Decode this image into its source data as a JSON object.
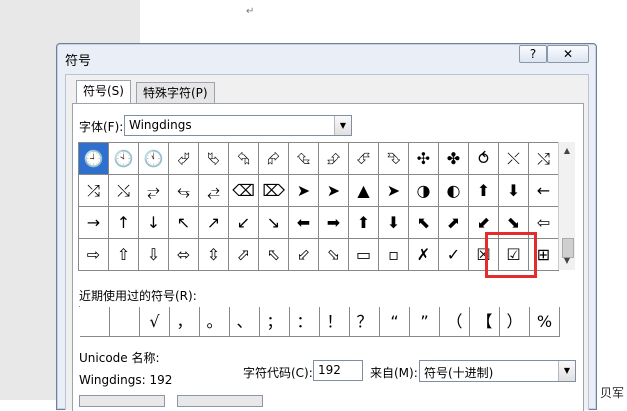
{
  "doc": {
    "paragraph_mark": "↵",
    "watermark": "贝军"
  },
  "dialog": {
    "title": "符号",
    "help_label": "?",
    "close_label": "✕",
    "tabs": [
      {
        "label": "符号(S)"
      },
      {
        "label": "特殊字符(P)"
      }
    ],
    "font_label": "字体(F):",
    "font_value": "Wingdings",
    "recent_label": "近期使用过的符号(R):",
    "unicode_name_label": "Unicode 名称:",
    "unicode_name_value": "Wingdings: 192",
    "char_code_label": "字符代码(C):",
    "char_code_value": "192",
    "from_label": "来自(M):",
    "from_value": "符号(十进制)"
  },
  "symbols": [
    [
      "🕘",
      "🕙",
      "🕚",
      "⮰",
      "⮱",
      "⮲",
      "⮳",
      "⮴",
      "⮵",
      "⮶",
      "⮷",
      "✣",
      "✤",
      "⥀",
      "⤬",
      "⤭"
    ],
    [
      "⤮",
      "⤯",
      "⥂",
      "⥃",
      "⥄",
      "⌫",
      "⌦",
      "➤",
      "➤",
      "▲",
      "➤",
      "◑",
      "◐",
      "⬆",
      "⬇",
      "←"
    ],
    [
      "→",
      "↑",
      "↓",
      "↖",
      "↗",
      "↙",
      "↘",
      "⬅",
      "➡",
      "⬆",
      "⬇",
      "⬉",
      "⬈",
      "⬋",
      "⬊",
      "⇦"
    ],
    [
      "⇨",
      "⇧",
      "⇩",
      "⬄",
      "⇳",
      "⬀",
      "⬁",
      "⬃",
      "⬂",
      "▭",
      "▫",
      "✗",
      "✓",
      "☒",
      "☑",
      "⊞"
    ]
  ],
  "recent": [
    "",
    "",
    "√",
    "，",
    "。",
    "、",
    "；",
    "：",
    "！",
    "？",
    "“",
    "”",
    "（",
    "【",
    "）",
    "%"
  ],
  "selected": {
    "row": 0,
    "col": 0
  },
  "colors": {
    "selection": "#2f6fce",
    "highlight": "#e52b2b"
  }
}
